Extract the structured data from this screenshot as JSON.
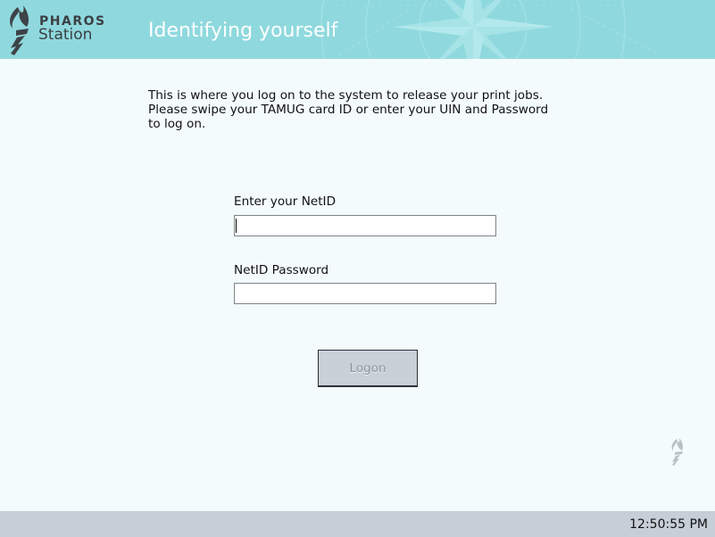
{
  "header": {
    "logo_line1": "PHAROS",
    "logo_line2": "Station",
    "title": "Identifying yourself"
  },
  "main": {
    "instructions": "This is where you log on to the system to release your print jobs.\nPlease swipe your TAMUG card ID or enter your UIN and Password\nto log on.",
    "netid": {
      "label": "Enter your NetID",
      "value": "",
      "placeholder": ""
    },
    "password": {
      "label": "NetID Password",
      "value": "",
      "placeholder": ""
    },
    "logon_label": "Logon"
  },
  "footer": {
    "clock": "12:50:55 PM"
  },
  "colors": {
    "header_bg": "#8fd9de",
    "page_bg": "#f4fbfd",
    "footer_bg": "#c6ced8",
    "button_bg": "#c9d0d8"
  },
  "icons": {
    "brand": "pharos-torch-icon",
    "header_decoration": "compass-rose-icon"
  }
}
